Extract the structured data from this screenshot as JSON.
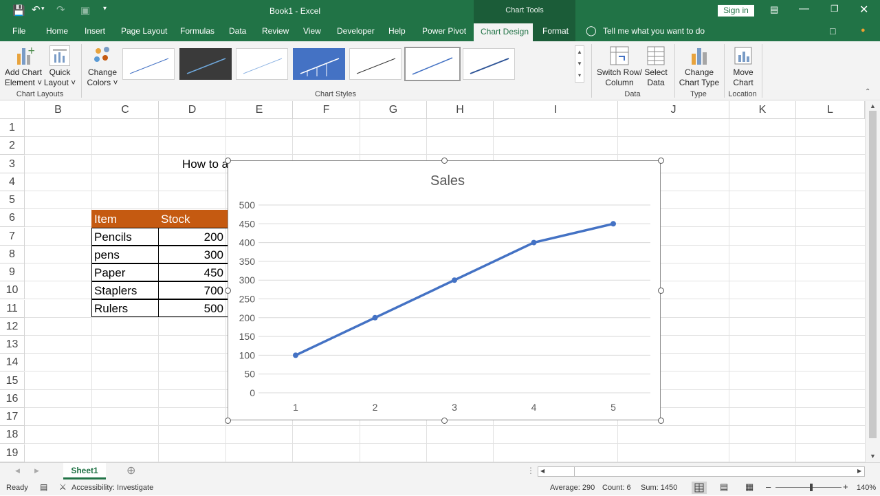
{
  "title_bar": {
    "document_title": "Book1 - Excel",
    "context_tools": "Chart Tools",
    "sign_in": "Sign in",
    "icons": [
      "save-icon",
      "undo-icon",
      "redo-icon",
      "camera-icon",
      "customize-icon",
      "ribbon-display-icon",
      "minimize-icon",
      "restore-icon",
      "close-icon"
    ]
  },
  "menu": {
    "file": "File",
    "tabs": [
      "Home",
      "Insert",
      "Page Layout",
      "Formulas",
      "Data",
      "Review",
      "View",
      "Developer",
      "Help",
      "Power Pivot"
    ],
    "active_tab": "Chart Design",
    "format_tab": "Format",
    "tell_me": "Tell me what you want to do"
  },
  "ribbon": {
    "add_chart_element": [
      "Add Chart",
      "Element ˅"
    ],
    "quick_layout": [
      "Quick",
      "Layout ˅"
    ],
    "chart_layouts_group": "Chart Layouts",
    "change_colors": [
      "Change",
      "Colors ˅"
    ],
    "chart_styles_group": "Chart Styles",
    "switch_row_col": [
      "Switch Row/",
      "Column"
    ],
    "select_data": [
      "Select",
      "Data"
    ],
    "data_group": "Data",
    "change_chart_type": [
      "Change",
      "Chart Type"
    ],
    "type_group": "Type",
    "move_chart": [
      "Move",
      "Chart"
    ],
    "location_group": "Location"
  },
  "columns": [
    "B",
    "C",
    "D",
    "E",
    "F",
    "G",
    "H",
    "I",
    "J",
    "K",
    "L"
  ],
  "rows": [
    "1",
    "2",
    "3",
    "4",
    "5",
    "6",
    "7",
    "8",
    "9",
    "10",
    "11",
    "12",
    "13",
    "14",
    "15",
    "16",
    "17",
    "18",
    "19"
  ],
  "cells": {
    "d3": "How to a",
    "header_item": "Item",
    "header_stock": "Stock",
    "items": [
      "Pencils",
      "pens",
      "Paper",
      "Staplers",
      "Rulers"
    ],
    "stocks": [
      "200",
      "300",
      "450",
      "700",
      "500"
    ]
  },
  "chart_data": {
    "type": "line",
    "title": "Sales",
    "x": [
      1,
      2,
      3,
      4,
      5
    ],
    "series": [
      {
        "values": [
          100,
          200,
          300,
          400,
          450
        ]
      }
    ],
    "ylim": [
      0,
      500
    ],
    "yticks": [
      "0",
      "50",
      "100",
      "150",
      "200",
      "250",
      "300",
      "350",
      "400",
      "450",
      "500"
    ],
    "xticks": [
      "1",
      "2",
      "3",
      "4",
      "5"
    ],
    "grid": true,
    "line_color": "#4472c4"
  },
  "sheets": {
    "active": "Sheet1"
  },
  "status": {
    "ready": "Ready",
    "accessibility": "Accessibility: Investigate",
    "average": "Average: 290",
    "count": "Count: 6",
    "sum": "Sum: 1450",
    "zoom": "140%"
  },
  "colors": {
    "excel_green": "#217346",
    "table_header": "#c55a11"
  }
}
